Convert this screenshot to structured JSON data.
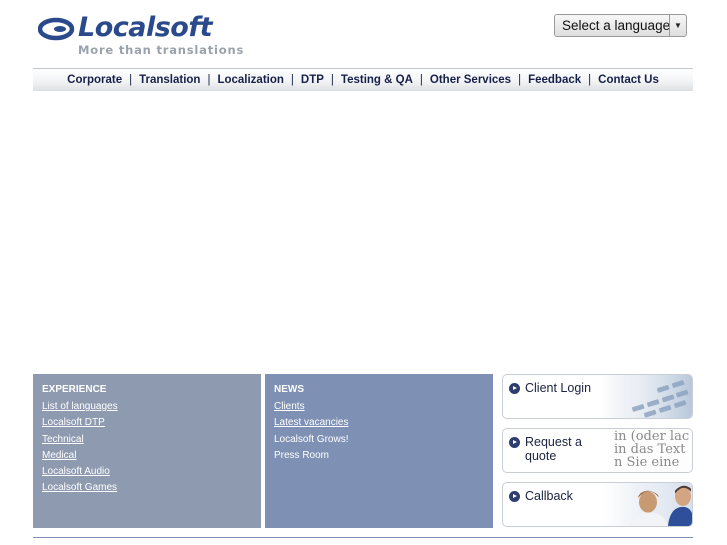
{
  "logo": {
    "wordmark": "Localsoft",
    "tagline": "More than translations"
  },
  "language_select": {
    "selected": "Select a language"
  },
  "nav": {
    "items": [
      "Corporate",
      "Translation",
      "Localization",
      "DTP",
      "Testing & QA",
      "Other Services",
      "Feedback",
      "Contact Us"
    ]
  },
  "experience": {
    "title": "EXPERIENCE",
    "links": [
      "List of languages",
      "Localsoft DTP",
      "Technical",
      "Medical",
      "Localsoft Audio",
      "Localsoft Games"
    ]
  },
  "news": {
    "title": "NEWS",
    "links": [
      "Clients",
      "Latest vacancies"
    ],
    "items": [
      "Localsoft Grows!",
      "Press Room"
    ]
  },
  "side_buttons": {
    "login": "Client Login",
    "quote_line1": "Request a",
    "quote_line2": "quote",
    "quote_art_lines": [
      "in (oder lac",
      "in das Text",
      "n Sie eine"
    ],
    "callback": "Callback"
  },
  "colors": {
    "brand_blue": "#2a4a8c",
    "experience_panel": "#8e9ab0",
    "news_panel": "#7e90b4",
    "nav_text": "#17204a"
  }
}
